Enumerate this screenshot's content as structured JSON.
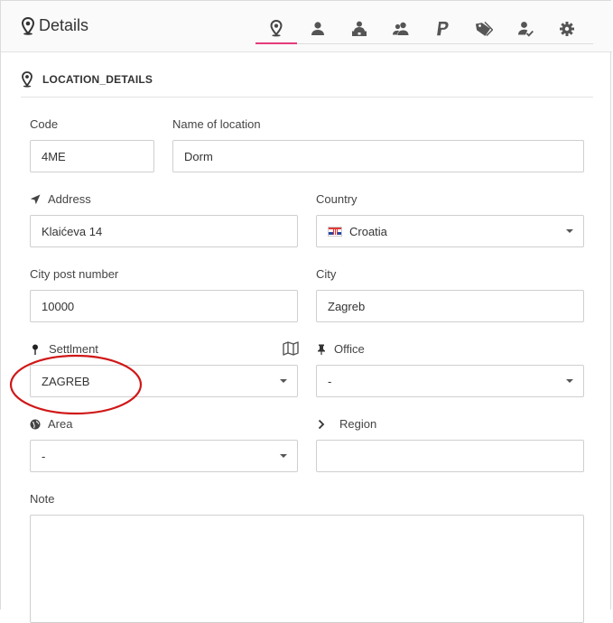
{
  "header": {
    "title": "Details",
    "tabs": [
      {
        "icon": "location-icon",
        "active": true
      },
      {
        "icon": "person-icon",
        "active": false
      },
      {
        "icon": "person-desk-icon",
        "active": false
      },
      {
        "icon": "people-icon",
        "active": false
      },
      {
        "icon": "paypal-icon",
        "active": false
      },
      {
        "icon": "tags-icon",
        "active": false
      },
      {
        "icon": "user-check-icon",
        "active": false
      },
      {
        "icon": "gear-icon",
        "active": false
      }
    ]
  },
  "section": {
    "title": "LOCATION_DETAILS"
  },
  "form": {
    "code": {
      "label": "Code",
      "value": "4ME"
    },
    "name": {
      "label": "Name of location",
      "value": "Dorm"
    },
    "address": {
      "label": "Address",
      "value": "Klaićeva 14",
      "icon": "send-arrow-icon"
    },
    "country": {
      "label": "Country",
      "value": "Croatia",
      "icon": "croatia-flag-icon"
    },
    "post": {
      "label": "City post number",
      "value": "10000"
    },
    "city": {
      "label": "City",
      "value": "Zagreb"
    },
    "settlment": {
      "label": "Settlment",
      "value": "ZAGREB",
      "icon": "pin-icon"
    },
    "office": {
      "label": "Office",
      "value": "-",
      "icon": "pushpin-icon"
    },
    "area": {
      "label": "Area",
      "value": "-",
      "icon": "globe-icon"
    },
    "region": {
      "label": "Region",
      "value": "",
      "icon": "chevron-right-icon"
    },
    "note": {
      "label": "Note",
      "value": ""
    }
  },
  "colors": {
    "accent": "#e6397a",
    "annotation": "#d01818",
    "icon": "#555555"
  }
}
